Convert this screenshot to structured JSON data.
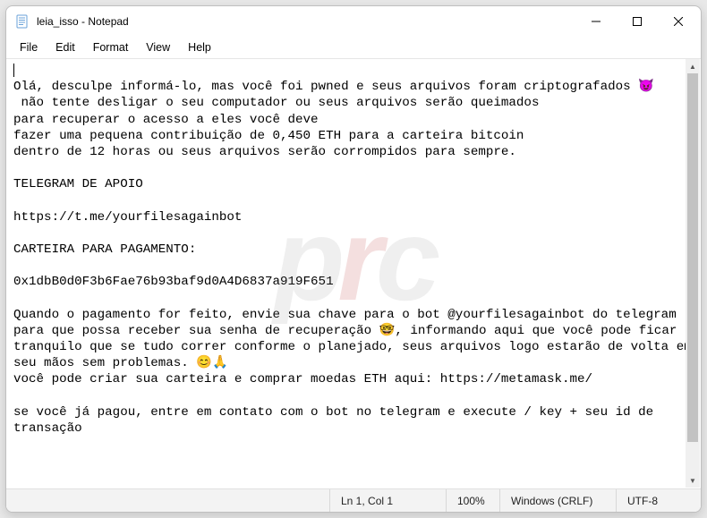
{
  "window": {
    "title": "leia_isso - Notepad"
  },
  "menubar": {
    "file": "File",
    "edit": "Edit",
    "format": "Format",
    "view": "View",
    "help": "Help"
  },
  "editor": {
    "content": "\nOlá, desculpe informá-lo, mas você foi pwned e seus arquivos foram criptografados 😈\n não tente desligar o seu computador ou seus arquivos serão queimados\npara recuperar o acesso a eles você deve\nfazer uma pequena contribuição de 0,450 ETH para a carteira bitcoin\ndentro de 12 horas ou seus arquivos serão corrompidos para sempre.\n\nTELEGRAM DE APOIO\n\nhttps://t.me/yourfilesagainbot\n\nCARTEIRA PARA PAGAMENTO:\n\n0x1dbB0d0F3b6Fae76b93baf9d0A4D6837a919F651\n\nQuando o pagamento for feito, envie sua chave para o bot @yourfilesagainbot do telegram para que possa receber sua senha de recuperação 🤓, informando aqui que você pode ficar tranquilo que se tudo correr conforme o planejado, seus arquivos logo estarão de volta em seu mãos sem problemas. 😊🙏\nvocê pode criar sua carteira e comprar moedas ETH aqui: https://metamask.me/\n\nse você já pagou, entre em contato com o bot no telegram e execute / key + seu id de transação"
  },
  "statusbar": {
    "position": "Ln 1, Col 1",
    "zoom": "100%",
    "line_ending": "Windows (CRLF)",
    "encoding": "UTF-8"
  },
  "watermark": {
    "text_prefix": "p",
    "text_accent": "r",
    "text_suffix": "c"
  }
}
